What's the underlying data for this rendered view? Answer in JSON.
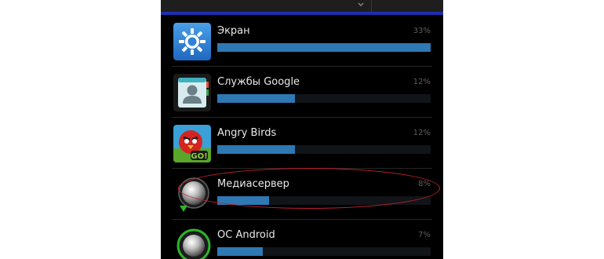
{
  "battery_usage": {
    "items": [
      {
        "name": "Экран",
        "percent_label": "33%",
        "usage_percent": 33,
        "icon": "display-brightness-icon"
      },
      {
        "name": "Службы Google",
        "percent_label": "12%",
        "usage_percent": 12,
        "icon": "google-services-contacts-icon"
      },
      {
        "name": "Angry Birds",
        "percent_label": "12%",
        "usage_percent": 12,
        "icon": "angry-birds-go-icon"
      },
      {
        "name": "Медиасервер",
        "percent_label": "8%",
        "usage_percent": 8,
        "icon": "mediaserver-android-icon"
      },
      {
        "name": "ОС Android",
        "percent_label": "7%",
        "usage_percent": 7,
        "icon": "android-os-icon"
      }
    ],
    "highlighted_item": "Медиасервер"
  },
  "colors": {
    "screen_background": "#000000",
    "bar_fill": "#2e78b4",
    "bar_track": "#111418",
    "accent_line": "#1b2fb0",
    "highlight_annotation": "#c0202c",
    "text_primary": "#e8e8e8",
    "text_secondary": "#5e5e5e"
  }
}
